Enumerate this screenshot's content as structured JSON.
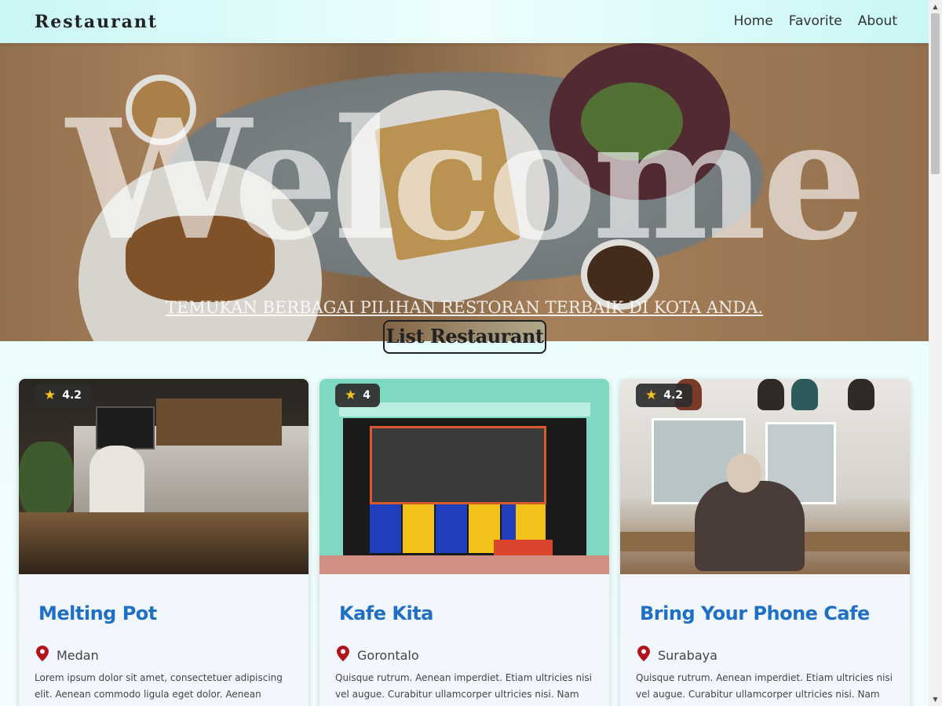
{
  "header": {
    "brand": "Restaurant",
    "nav": [
      {
        "label": "Home"
      },
      {
        "label": "Favorite"
      },
      {
        "label": "About"
      }
    ]
  },
  "hero": {
    "title": "Welcome",
    "subtitle": "TEMUKAN BERBAGAI PILIHAN RESTORAN TERBAIK DI KOTA ANDA."
  },
  "section": {
    "title": "List Restaurant"
  },
  "restaurants": [
    {
      "rating": "4.2",
      "name": "Melting Pot",
      "city": "Medan",
      "description": "Lorem ipsum dolor sit amet, consectetuer adipiscing elit. Aenean commodo ligula eget dolor. Aenean massa. Cum sociis natoque penatibus et magnis dis parturient monte"
    },
    {
      "rating": "4",
      "name": "Kafe Kita",
      "city": "Gorontalo",
      "description": "Quisque rutrum. Aenean imperdiet. Etiam ultricies nisi vel augue. Curabitur ullamcorper ultricies nisi. Nam eget dui. Etiam rhoncus. Maecenas tempus, tellus eget"
    },
    {
      "rating": "4.2",
      "name": "Bring Your Phone Cafe",
      "city": "Surabaya",
      "description": "Quisque rutrum. Aenean imperdiet. Etiam ultricies nisi vel augue. Curabitur ullamcorper ultricies nisi. Nam eget dui. Etiam rhoncus. Maecenas tempus, tellus eget"
    }
  ],
  "colors": {
    "accent_name": "#1f6fc4",
    "pin": "#b3141b",
    "star": "#f6c21c"
  },
  "icons": {
    "rating": "star-icon",
    "location": "location-pin-icon"
  }
}
